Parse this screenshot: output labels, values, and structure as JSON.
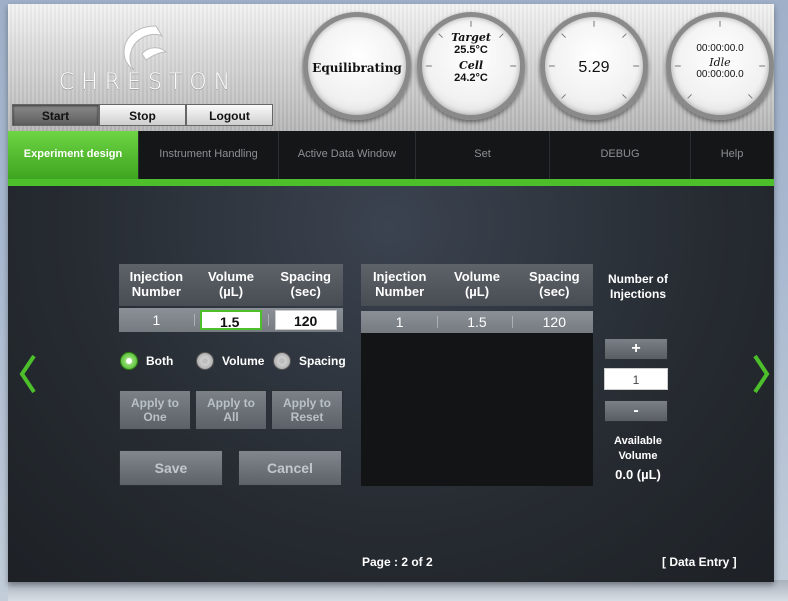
{
  "app": {
    "brand": "CHRESTON"
  },
  "header_buttons": [
    {
      "label": "Start",
      "active": true
    },
    {
      "label": "Stop",
      "active": false
    },
    {
      "label": "Logout",
      "active": false
    }
  ],
  "gauges": {
    "status": "Equilibrating",
    "target_label": "Target",
    "target_value": "25.5°C",
    "cell_label": "Cell",
    "cell_value": "24.2°C",
    "reading": "5.29",
    "timer_top": "00:00:00.0",
    "timer_state": "Idle",
    "timer_bottom": "00:00:00.0"
  },
  "nav": [
    {
      "label": "Experiment design",
      "active": true
    },
    {
      "label": "Instrument Handling",
      "active": false
    },
    {
      "label": "Active Data Window",
      "active": false
    },
    {
      "label": "Set",
      "active": false
    },
    {
      "label": "DEBUG",
      "active": false
    },
    {
      "label": "Help",
      "active": false
    }
  ],
  "editor": {
    "headers": [
      "Injection\nNumber",
      "Volume\n(µL)",
      "Spacing\n(sec)"
    ],
    "header_injection": "Injection",
    "header_injection2": "Number",
    "header_volume": "Volume",
    "header_volume2": "(µL)",
    "header_spacing": "Spacing",
    "header_spacing2": "(sec)",
    "row_number": "1",
    "volume_value": "1.5",
    "spacing_value": "120"
  },
  "radios": [
    {
      "label": "Both",
      "checked": true
    },
    {
      "label": "Volume",
      "checked": false
    },
    {
      "label": "Spacing",
      "checked": false
    }
  ],
  "apply_buttons": {
    "one_line1": "Apply to",
    "one_line2": "One",
    "all_line1": "Apply to",
    "all_line2": "All",
    "reset_line1": "Apply to",
    "reset_line2": "Reset"
  },
  "actions": {
    "save": "Save",
    "cancel": "Cancel"
  },
  "list": {
    "header_injection": "Injection",
    "header_injection2": "Number",
    "header_volume": "Volume",
    "header_volume2": "(µL)",
    "header_spacing": "Spacing",
    "header_spacing2": "(sec)",
    "rows": [
      {
        "number": "1",
        "volume": "1.5",
        "spacing": "120"
      }
    ]
  },
  "injections": {
    "title1": "Number of",
    "title2": "Injections",
    "plus": "+",
    "count": "1",
    "minus": "-",
    "available1": "Available",
    "available2": "Volume",
    "available_value": "0.0  (µL)"
  },
  "footer": {
    "page": "Page : 2 of 2",
    "mode": "[ Data Entry ]"
  },
  "colors": {
    "accent": "#4cbf2a",
    "nav_bg": "#141618",
    "panel": "#5d6369"
  }
}
